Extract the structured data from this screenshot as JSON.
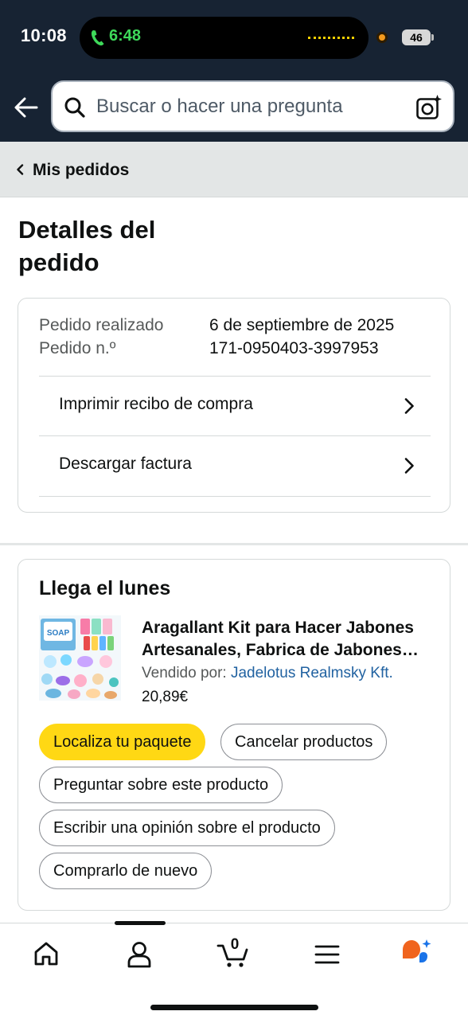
{
  "status_bar": {
    "time": "10:08",
    "call_time": "6:48",
    "battery": "46"
  },
  "search": {
    "placeholder": "Buscar o hacer una pregunta"
  },
  "breadcrumb": {
    "label": "Mis pedidos"
  },
  "page": {
    "title": "Detalles del pedido"
  },
  "order": {
    "placed_label": "Pedido realizado",
    "placed_value": "6 de septiembre de 2025",
    "number_label": "Pedido n.º",
    "number_value": "171-0950403-3997953",
    "links": [
      {
        "label": "Imprimir recibo de compra"
      },
      {
        "label": "Descargar factura"
      }
    ]
  },
  "shipment": {
    "title": "Llega el lunes",
    "product": {
      "title_line1": "Aragallant Kit para Hacer Jabones",
      "title_line2": "Artesanales, Fabrica de Jabones…",
      "sold_by_label": "Vendido por:",
      "seller": "Jadelotus Realmsky Kft.",
      "price": "20,89€",
      "image_text": "SOAP"
    },
    "actions": {
      "track": "Localiza tu paquete",
      "cancel": "Cancelar productos",
      "ask": "Preguntar sobre este producto",
      "review": "Escribir una opinión sobre el producto",
      "buy_again": "Comprarlo de nuevo"
    }
  },
  "bottom_nav": {
    "items": [
      "home-icon",
      "account-icon",
      "cart-icon",
      "menu-icon",
      "rufus-icon"
    ],
    "cart_count": "0"
  },
  "colors": {
    "header_bg": "#172333",
    "primary_button": "#ffd814",
    "link": "#2162a1",
    "breadcrumb_bg": "#e3e6e6"
  }
}
